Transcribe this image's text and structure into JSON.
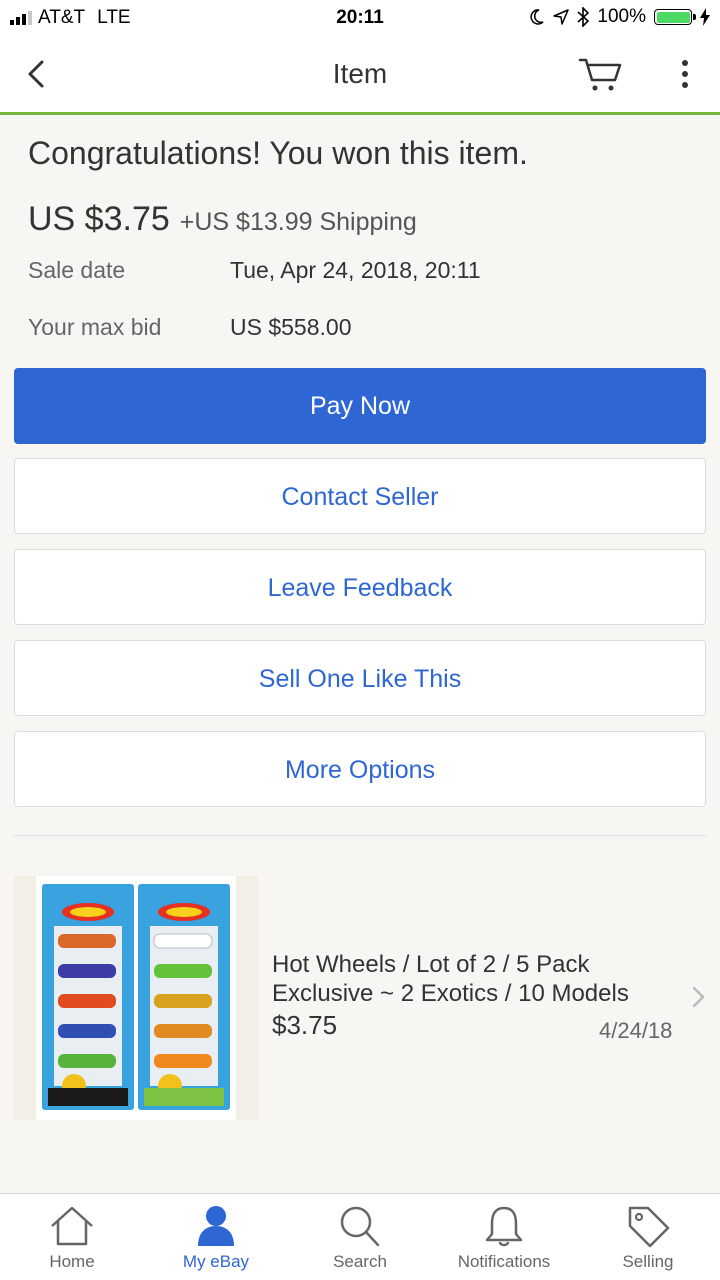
{
  "status_bar": {
    "carrier": "AT&T",
    "network": "LTE",
    "time": "20:11",
    "battery": "100%"
  },
  "nav": {
    "title": "Item"
  },
  "order": {
    "headline": "Congratulations! You won this item.",
    "price": "US $3.75",
    "shipping": "+US $13.99 Shipping",
    "sale_date_label": "Sale date",
    "sale_date_value": "Tue, Apr 24, 2018, 20:11",
    "max_bid_label": "Your max bid",
    "max_bid_value": "US $558.00"
  },
  "actions": {
    "pay_now": "Pay Now",
    "contact_seller": "Contact Seller",
    "leave_feedback": "Leave Feedback",
    "sell_one_like_this": "Sell One Like This",
    "more_options": "More Options"
  },
  "item": {
    "title": "Hot Wheels / Lot of 2 / 5 Pack Exclusive ~ 2 Exotics / 10 Models",
    "price": "$3.75",
    "date": "4/24/18"
  },
  "tabs": [
    {
      "label": "Home",
      "icon": "home-icon"
    },
    {
      "label": "My eBay",
      "icon": "person-icon"
    },
    {
      "label": "Search",
      "icon": "search-icon"
    },
    {
      "label": "Notifications",
      "icon": "bell-icon"
    },
    {
      "label": "Selling",
      "icon": "tag-icon"
    }
  ],
  "colors": {
    "accent": "#2e66d4",
    "nav_underline": "#78b640",
    "battery": "#4cd964"
  }
}
